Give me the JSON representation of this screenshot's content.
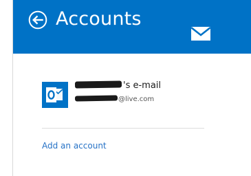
{
  "header": {
    "title": "Accounts",
    "back_icon": "back-arrow-circle-icon",
    "mail_icon": "mail-envelope-icon",
    "background_color": "#0072c6"
  },
  "account": {
    "icon": "outlook-icon",
    "name_suffix": "'s e-mail",
    "email_domain": "@live.com",
    "tile_color": "#0072c6"
  },
  "actions": {
    "add_account_label": "Add an account",
    "link_color": "#2672c6"
  }
}
